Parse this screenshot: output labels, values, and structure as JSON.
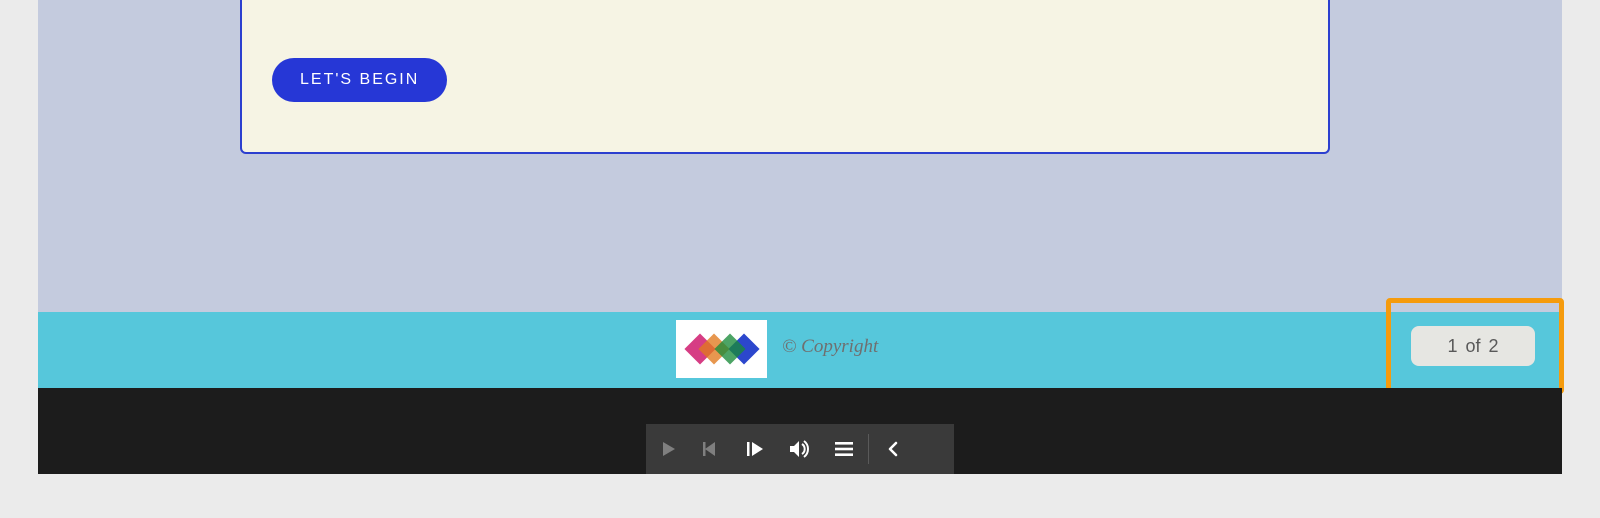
{
  "card": {
    "begin_label": "LET'S BEGIN"
  },
  "footer": {
    "copyright": "© Copyright"
  },
  "pagination": {
    "current": "1",
    "of_label": "of",
    "total": "2"
  },
  "icons": {
    "play": "play-icon",
    "step_back": "step-back-icon",
    "step_forward": "step-forward-icon",
    "volume": "volume-icon",
    "menu": "menu-icon",
    "chevron_left": "chevron-left-icon"
  },
  "colors": {
    "accent_blue": "#2637d6",
    "cyan": "#56c7db",
    "highlight": "#f59b0d",
    "card_bg": "#f6f4e4",
    "content_bg": "#c4cbde"
  }
}
